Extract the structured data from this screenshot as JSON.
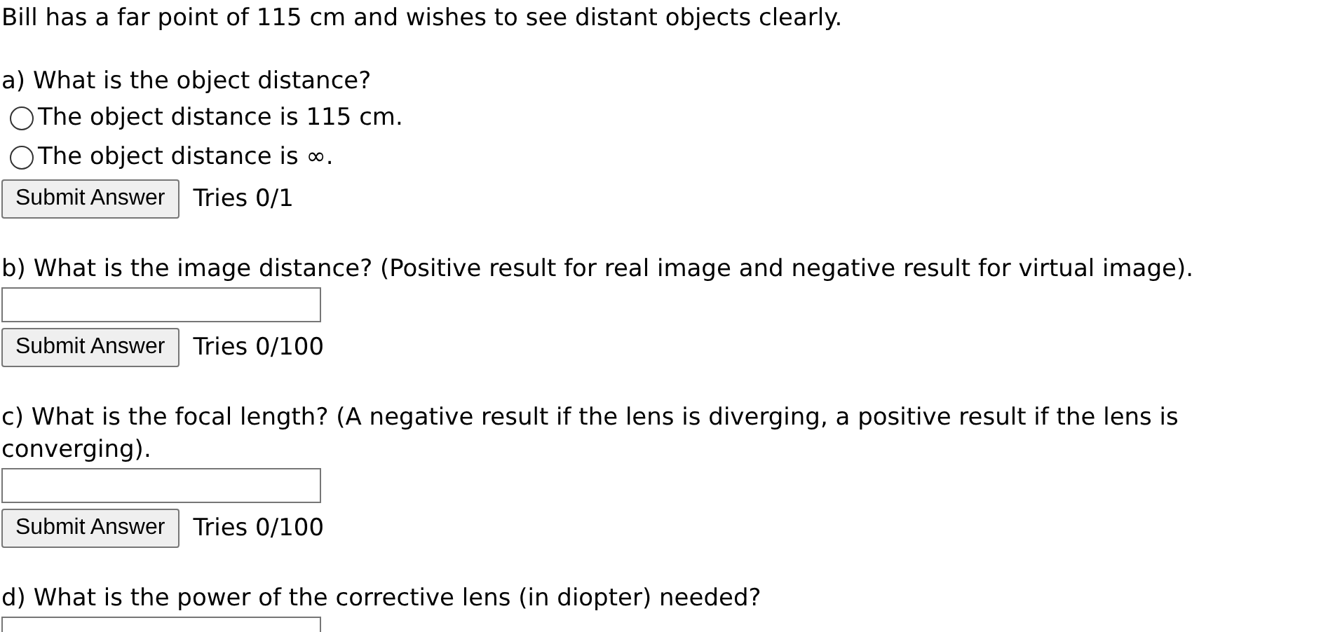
{
  "intro": "Bill has a far point of 115 cm and wishes to see distant objects clearly.",
  "parts": [
    {
      "kind": "choice",
      "question": "a) What is the object distance?",
      "options": [
        {
          "label": "The object distance is 115 cm.",
          "selected": false
        },
        {
          "label": "The object distance is ∞.",
          "selected": false
        }
      ],
      "button": "Submit Answer",
      "tries": "Tries 0/1"
    },
    {
      "kind": "numeric",
      "question": "b) What is the image distance? (Positive result for real image and negative result for virtual image).",
      "button": "Submit Answer",
      "tries": "Tries 0/100"
    },
    {
      "kind": "numeric",
      "question": "c) What is the focal length? (A negative result if the lens is diverging, a positive result if the lens is converging).",
      "button": "Submit Answer",
      "tries": "Tries 0/100"
    },
    {
      "kind": "numeric",
      "question": "d) What is the power of the corrective lens (in diopter) needed?"
    }
  ]
}
